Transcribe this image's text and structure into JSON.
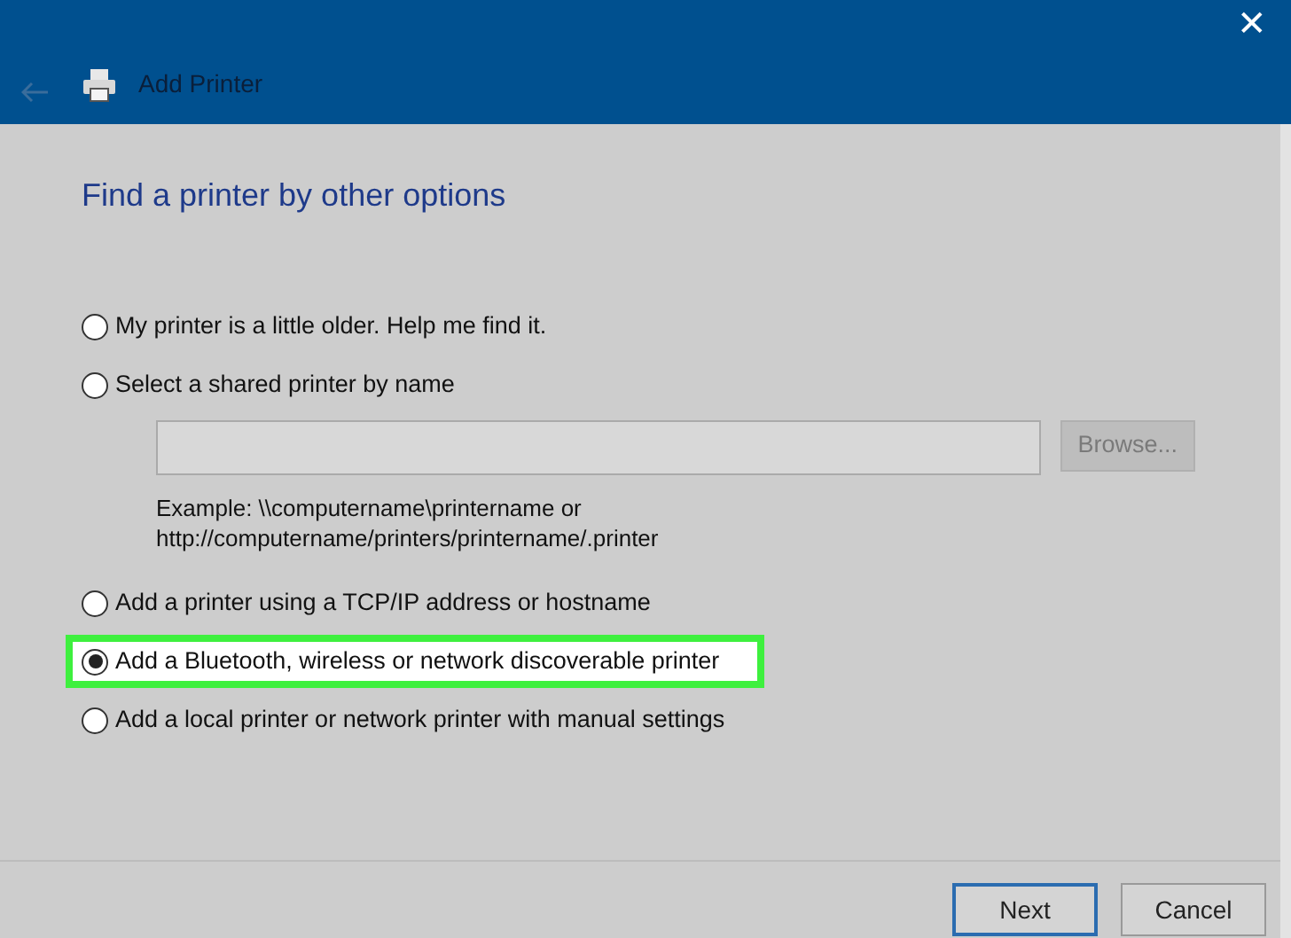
{
  "window": {
    "title": "Add Printer",
    "close": "✕"
  },
  "heading": "Find a printer by other options",
  "options": [
    {
      "kind": "radio",
      "label": "My printer is a little older. Help me find it.",
      "selected": false
    },
    {
      "kind": "radio_with_field",
      "label": "Select a shared printer by name",
      "selected": false,
      "field": {
        "button": "Browse...",
        "disabled": true
      },
      "example": [
        "Example: \\\\computername\\printername or",
        "http://computername/printers/printername/.printer"
      ]
    },
    {
      "kind": "radio",
      "label": "Add a printer using a TCP/IP address or hostname",
      "selected": false
    },
    {
      "kind": "radio",
      "label": "Add a Bluetooth, wireless or network discoverable printer",
      "selected": true
    },
    {
      "kind": "radio",
      "label": "Add a local printer or network printer with manual settings",
      "selected": false
    }
  ],
  "buttons": [
    {
      "label": "Next",
      "default": true
    },
    {
      "label": "Cancel",
      "default": false
    }
  ]
}
